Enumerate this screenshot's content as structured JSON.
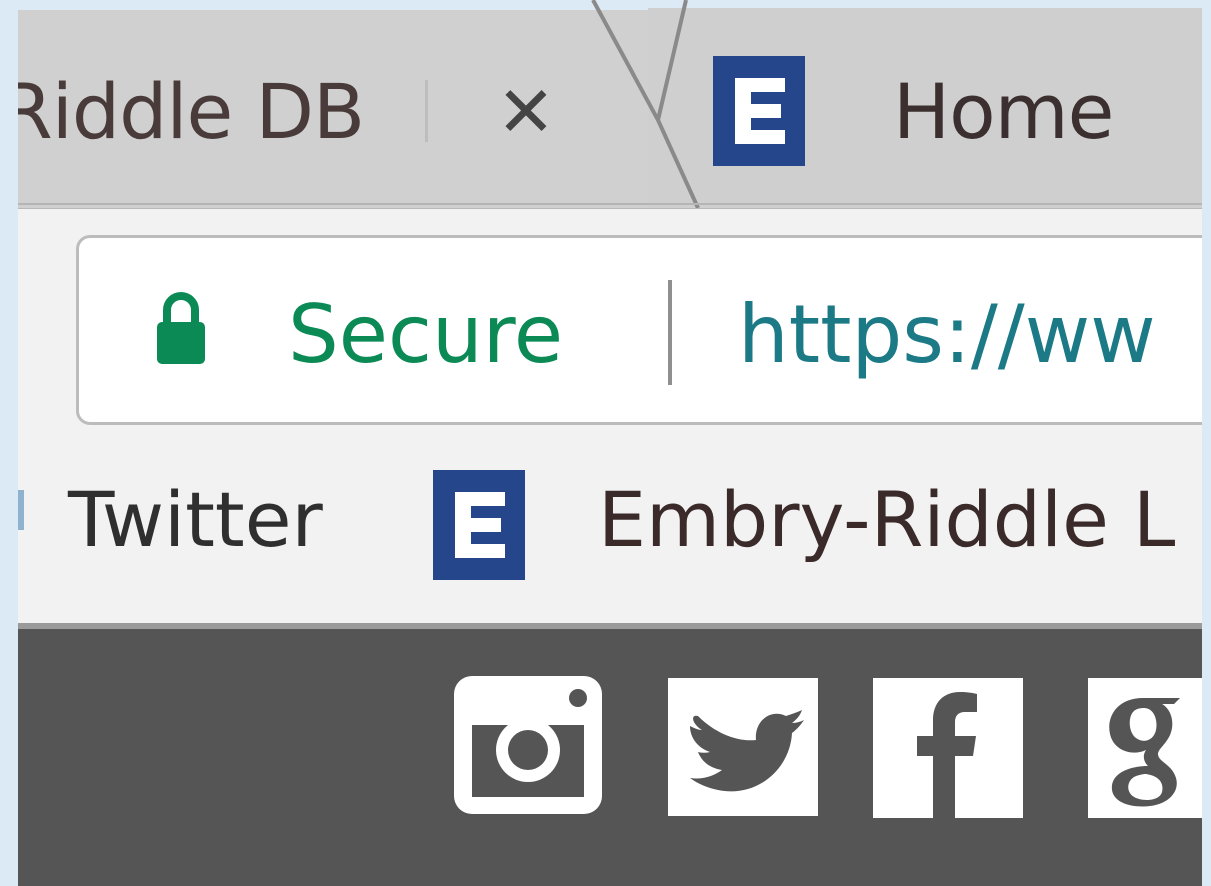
{
  "browser": {
    "tabs": [
      {
        "title": "Riddle DB",
        "close_glyph": "✕",
        "icon": "none",
        "active": false
      },
      {
        "title": "Home",
        "icon": "erau-e-logo",
        "active": true
      }
    ],
    "address_bar": {
      "security_label": "Secure",
      "security_icon": "lock-icon",
      "url": "https://ww"
    },
    "bookmarks": [
      {
        "label": "Twitter",
        "icon": "none"
      },
      {
        "label": "Embry-Riddle L",
        "icon": "erau-e-logo"
      }
    ]
  },
  "site": {
    "social_icons": [
      "instagram-icon",
      "twitter-icon",
      "facebook-icon",
      "google-plus-icon"
    ]
  },
  "colors": {
    "secure_green": "#0b8a56",
    "url_teal": "#1b7a86",
    "erau_blue": "#26468c",
    "site_bar_gray": "#555555",
    "tab_gray": "#d0d0d0",
    "toolbar_bg": "#f2f2f2"
  }
}
